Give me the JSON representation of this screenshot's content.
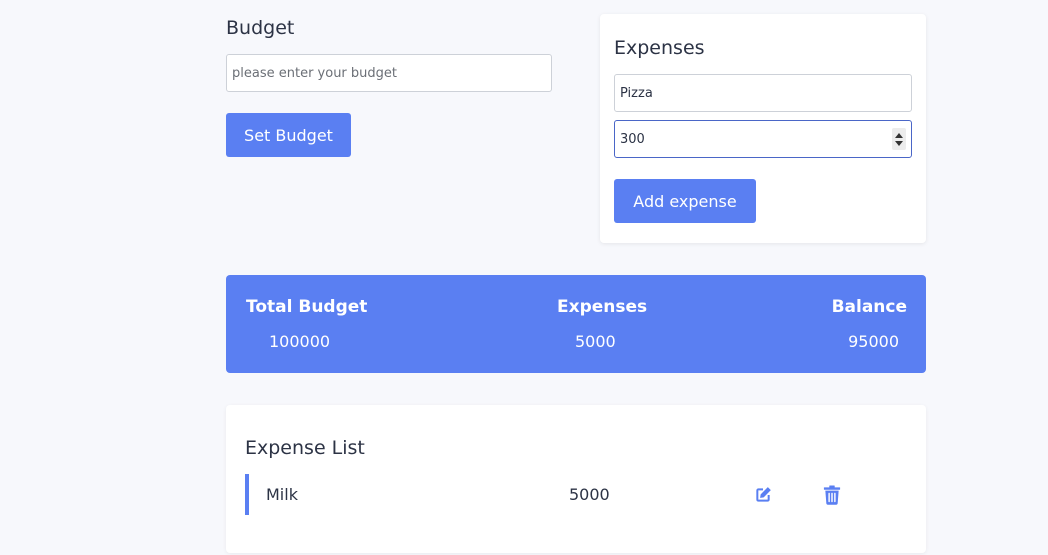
{
  "budget": {
    "title": "Budget",
    "input_placeholder": "please enter your budget",
    "input_value": "",
    "set_button_label": "Set Budget"
  },
  "expense_form": {
    "title": "Expenses",
    "name_value": "Pizza",
    "amount_value": "300",
    "add_button_label": "Add expense"
  },
  "summary": {
    "total_budget_label": "Total Budget",
    "total_budget_value": "100000",
    "expenses_label": "Expenses",
    "expenses_value": "5000",
    "balance_label": "Balance",
    "balance_value": "95000"
  },
  "expense_list": {
    "title": "Expense List",
    "items": [
      {
        "name": "Milk",
        "amount": "5000"
      }
    ]
  },
  "icons": {
    "edit": "edit-icon",
    "delete": "trash-icon"
  },
  "colors": {
    "accent": "#5a7ff2",
    "background": "#f7f8fc",
    "text": "#2c3345"
  }
}
